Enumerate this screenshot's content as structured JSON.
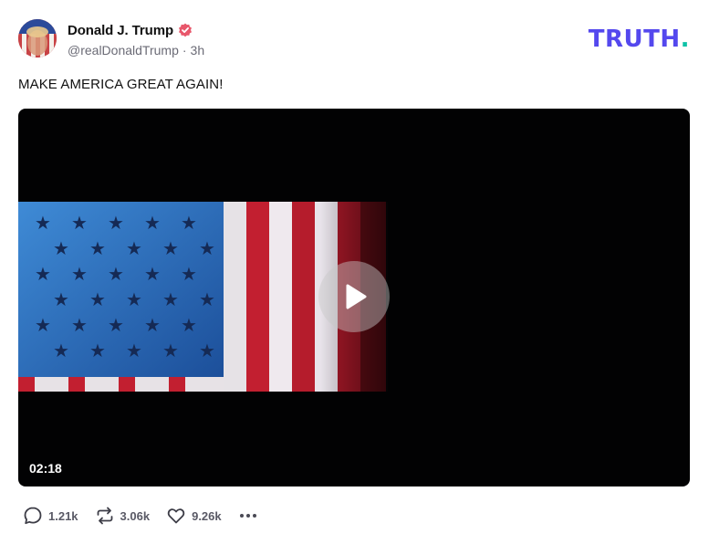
{
  "post": {
    "author": {
      "display_name": "Donald J. Trump",
      "handle": "@realDonaldTrump",
      "separator": "·",
      "time_ago": "3h",
      "verified_color": "#e8576b"
    },
    "brand": {
      "text": "TRUTH",
      "dot": ".",
      "color": "#5448ee",
      "dot_color": "#0ec2a7"
    },
    "text": "MAKE AMERICA GREAT AGAIN!",
    "video": {
      "duration": "02:18"
    },
    "actions": {
      "replies": "1.21k",
      "retruths": "3.06k",
      "likes": "9.26k"
    }
  }
}
